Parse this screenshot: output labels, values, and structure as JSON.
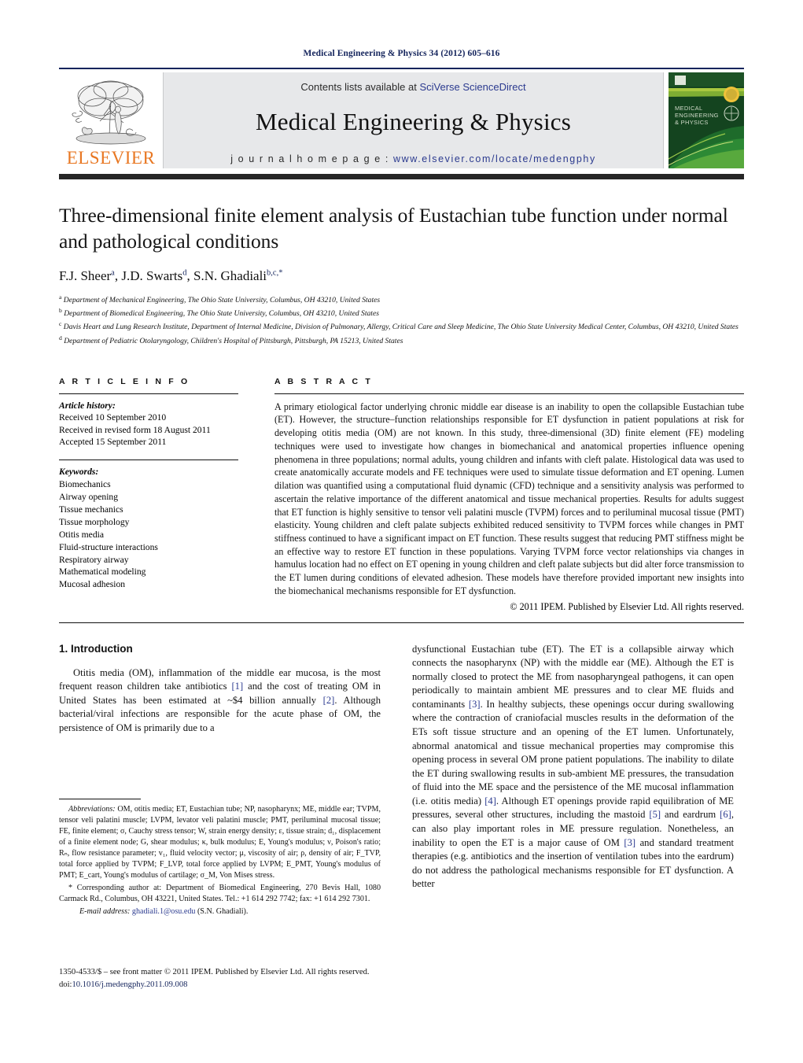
{
  "running_head": "Medical Engineering & Physics 34 (2012) 605–616",
  "banner": {
    "publisher_wordmark": "ELSEVIER",
    "contents_prefix": "Contents lists available at ",
    "contents_link": "SciVerse ScienceDirect",
    "journal_title": "Medical Engineering & Physics",
    "homepage_prefix": "j o u r n a l   h o m e p a g e :  ",
    "homepage_url": "www.elsevier.com/locate/medengphy",
    "cover_title_lines": [
      "MEDICAL",
      "ENGINEERING",
      "& PHYSICS"
    ],
    "accent_color": "#E87722",
    "link_color": "#2b3a8f",
    "banner_bg": "#e7e8ea"
  },
  "article": {
    "title": "Three-dimensional finite element analysis of Eustachian tube function under normal and pathological conditions",
    "authors_html": "F.J. Sheer<sup>a</sup>, J.D. Swarts<sup>d</sup>, S.N. Ghadiali<sup>b,c,</sup><sup>*</sup>",
    "affiliations": [
      {
        "marker": "a",
        "text": "Department of Mechanical Engineering, The Ohio State University, Columbus, OH 43210, United States"
      },
      {
        "marker": "b",
        "text": "Department of Biomedical Engineering, The Ohio State University, Columbus, OH 43210, United States"
      },
      {
        "marker": "c",
        "text": "Davis Heart and Lung Research Institute, Department of Internal Medicine, Division of Pulmonary, Allergy, Critical Care and Sleep Medicine, The Ohio State University Medical Center, Columbus, OH 43210, United States"
      },
      {
        "marker": "d",
        "text": "Department of Pediatric Otolaryngology, Children's Hospital of Pittsburgh, Pittsburgh, PA 15213, United States"
      }
    ]
  },
  "article_info": {
    "heading": "A R T I C L E   I N F O",
    "history_label": "Article history:",
    "history_lines": [
      "Received 10 September 2010",
      "Received in revised form 18 August 2011",
      "Accepted 15 September 2011"
    ],
    "keywords_label": "Keywords:",
    "keywords": [
      "Biomechanics",
      "Airway opening",
      "Tissue mechanics",
      "Tissue morphology",
      "Otitis media",
      "Fluid-structure interactions",
      "Respiratory airway",
      "Mathematical modeling",
      "Mucosal adhesion"
    ]
  },
  "abstract": {
    "heading": "A B S T R A C T",
    "text": "A primary etiological factor underlying chronic middle ear disease is an inability to open the collapsible Eustachian tube (ET). However, the structure–function relationships responsible for ET dysfunction in patient populations at risk for developing otitis media (OM) are not known. In this study, three-dimensional (3D) finite element (FE) modeling techniques were used to investigate how changes in biomechanical and anatomical properties influence opening phenomena in three populations; normal adults, young children and infants with cleft palate. Histological data was used to create anatomically accurate models and FE techniques were used to simulate tissue deformation and ET opening. Lumen dilation was quantified using a computational fluid dynamic (CFD) technique and a sensitivity analysis was performed to ascertain the relative importance of the different anatomical and tissue mechanical properties. Results for adults suggest that ET function is highly sensitive to tensor veli palatini muscle (TVPM) forces and to periluminal mucosal tissue (PMT) elasticity. Young children and cleft palate subjects exhibited reduced sensitivity to TVPM forces while changes in PMT stiffness continued to have a significant impact on ET function. These results suggest that reducing PMT stiffness might be an effective way to restore ET function in these populations. Varying TVPM force vector relationships via changes in hamulus location had no effect on ET opening in young children and cleft palate subjects but did alter force transmission to the ET lumen during conditions of elevated adhesion. These models have therefore provided important new insights into the biomechanical mechanisms responsible for ET dysfunction.",
    "copyright": "© 2011 IPEM. Published by Elsevier Ltd. All rights reserved."
  },
  "introduction": {
    "heading": "1.  Introduction",
    "left_paragraph_parts": [
      "Otitis media (OM), inflammation of the middle ear mucosa, is the most frequent reason children take antibiotics ",
      "[1]",
      " and the cost of treating OM in United States has been estimated at ~$4 billion annually ",
      "[2]",
      ". Although bacterial/viral infections are responsible for the acute phase of OM, the persistence of OM is primarily due to a"
    ],
    "right_paragraph_parts": [
      "dysfunctional Eustachian tube (ET). The ET is a collapsible airway which connects the nasopharynx (NP) with the middle ear (ME). Although the ET is normally closed to protect the ME from nasopharyngeal pathogens, it can open periodically to maintain ambient ME pressures and to clear ME fluids and contaminants ",
      "[3]",
      ". In healthy subjects, these openings occur during swallowing where the contraction of craniofacial muscles results in the deformation of the ETs soft tissue structure and an opening of the ET lumen. Unfortunately, abnormal anatomical and tissue mechanical properties may compromise this opening process in several OM prone patient populations. The inability to dilate the ET during swallowing results in sub-ambient ME pressures, the transudation of fluid into the ME space and the persistence of the ME mucosal inflammation (i.e. otitis media) ",
      "[4]",
      ". Although ET openings provide rapid equilibration of ME pressures, several other structures, including the mastoid ",
      "[5]",
      " and eardrum ",
      "[6]",
      ", can also play important roles in ME pressure regulation. Nonetheless, an inability to open the ET is a major cause of OM ",
      "[3]",
      " and standard treatment therapies (e.g. antibiotics and the insertion of ventilation tubes into the eardrum) do not address the pathological mechanisms responsible for ET dysfunction. A better"
    ]
  },
  "footnotes": {
    "abbreviations_label": "Abbreviations:",
    "abbreviations_text": "  OM, otitis media; ET, Eustachian tube; NP, nasopharynx; ME, middle ear; TVPM, tensor veli palatini muscle; LVPM, levator veli palatini muscle; PMT, periluminal mucosal tissue; FE, finite element; σ, Cauchy stress tensor; W, strain energy density; ε, tissue strain; d₁, displacement of a finite element node; G, shear modulus; κ, bulk modulus; E, Young's modulus; ν, Poison's ratio; Rₙ, flow resistance parameter; v₁, fluid velocity vector; μ, viscosity of air; ρ, density of air; F_TVP, total force applied by TVPM; F_LVP, total force applied by LVPM; E_PMT, Young's modulus of PMT; E_cart, Young's modulus of cartilage; σ_M, Von Mises stress.",
    "corresponding_marker": "*",
    "corresponding_text": " Corresponding author at: Department of Biomedical Engineering, 270 Bevis Hall, 1080 Carmack Rd., Columbus, OH 43221, United States. Tel.: +1 614 292 7742; fax: +1 614 292 7301.",
    "email_label": "E-mail address:",
    "email_address": "ghadiali.1@osu.edu",
    "email_suffix": " (S.N. Ghadiali)."
  },
  "footer": {
    "issn_line": "1350-4533/$ – see front matter © 2011 IPEM. Published by Elsevier Ltd. All rights reserved.",
    "doi_label": "doi:",
    "doi_value": "10.1016/j.medengphy.2011.09.008"
  }
}
